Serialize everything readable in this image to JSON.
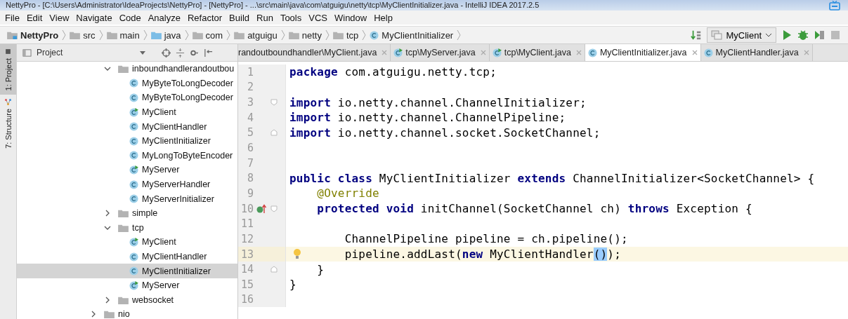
{
  "window": {
    "title": "NettyPro - [C:\\Users\\Administrator\\IdeaProjects\\NettyPro] - [NettyPro] - ...\\src\\main\\java\\com\\atguigu\\netty\\tcp\\MyClientInitializer.java - IntelliJ IDEA 2017.2.5"
  },
  "menu": [
    "File",
    "Edit",
    "View",
    "Navigate",
    "Code",
    "Analyze",
    "Refactor",
    "Build",
    "Run",
    "Tools",
    "VCS",
    "Window",
    "Help"
  ],
  "breadcrumbs": [
    {
      "label": "NettyPro",
      "kind": "module"
    },
    {
      "label": "src",
      "kind": "folder"
    },
    {
      "label": "main",
      "kind": "folder"
    },
    {
      "label": "java",
      "kind": "source"
    },
    {
      "label": "com",
      "kind": "package"
    },
    {
      "label": "atguigu",
      "kind": "package"
    },
    {
      "label": "netty",
      "kind": "package"
    },
    {
      "label": "tcp",
      "kind": "package"
    },
    {
      "label": "MyClientInitializer",
      "kind": "class"
    }
  ],
  "run_config": {
    "label": "MyClient"
  },
  "tool_windows": [
    {
      "label": "1: Project",
      "selected": true,
      "kind": "project"
    },
    {
      "label": "7: Structure",
      "selected": false,
      "kind": "structure"
    }
  ],
  "project_panel": {
    "title": "Project"
  },
  "tree": [
    {
      "children": [
        {
          "label": "inboundhandlerandoutbou",
          "kind": "folder",
          "expanded": true,
          "selected": false,
          "children": [
            {
              "label": "MyByteToLongDecoder",
              "kind": "class",
              "selected": false
            },
            {
              "label": "MyByteToLongDecoder",
              "kind": "class",
              "selected": false
            },
            {
              "label": "MyClient",
              "kind": "main_class",
              "selected": false
            },
            {
              "label": "MyClientHandler",
              "kind": "class",
              "selected": false
            },
            {
              "label": "MyClientInitializer",
              "kind": "class",
              "selected": false
            },
            {
              "label": "MyLongToByteEncoder",
              "kind": "class",
              "selected": false
            },
            {
              "label": "MyServer",
              "kind": "main_class",
              "selected": false
            },
            {
              "label": "MyServerHandler",
              "kind": "class",
              "selected": false
            },
            {
              "label": "MyServerInitializer",
              "kind": "class",
              "selected": false
            }
          ]
        },
        {
          "label": "simple",
          "kind": "folder",
          "expanded": false,
          "selected": false
        },
        {
          "label": "tcp",
          "kind": "folder",
          "expanded": true,
          "selected": false,
          "children": [
            {
              "label": "MyClient",
              "kind": "main_class",
              "selected": false
            },
            {
              "label": "MyClientHandler",
              "kind": "class",
              "selected": false
            },
            {
              "label": "MyClientInitializer",
              "kind": "class",
              "selected": true
            },
            {
              "label": "MyServer",
              "kind": "main_class",
              "selected": false
            }
          ]
        },
        {
          "label": "websocket",
          "kind": "folder",
          "expanded": false,
          "selected": false
        }
      ]
    },
    {
      "label": "nio",
      "kind": "folder",
      "expanded": false,
      "selected": false
    }
  ],
  "tabs": [
    {
      "label": "randoutboundhandler\\MyClient.java",
      "kind": "none",
      "selected": false
    },
    {
      "label": "tcp\\MyServer.java",
      "kind": "main_class",
      "selected": false
    },
    {
      "label": "tcp\\MyClient.java",
      "kind": "main_class",
      "selected": false
    },
    {
      "label": "MyClientInitializer.java",
      "kind": "class",
      "selected": true
    },
    {
      "label": "MyClientHandler.java",
      "kind": "class",
      "selected": false
    }
  ],
  "editor": {
    "lines": [
      {
        "number": "1",
        "segments": [
          {
            "kind": "keyword",
            "text": "package"
          },
          {
            "kind": "plain",
            "text": " com.atguigu.netty.tcp;"
          }
        ]
      },
      {
        "number": "2"
      },
      {
        "number": "3",
        "fold_start": true,
        "segments": [
          {
            "kind": "keyword",
            "text": "import"
          },
          {
            "kind": "plain",
            "text": " io.netty.channel.ChannelInitializer;"
          }
        ]
      },
      {
        "number": "4",
        "segments": [
          {
            "kind": "keyword",
            "text": "import"
          },
          {
            "kind": "plain",
            "text": " io.netty.channel.ChannelPipeline;"
          }
        ]
      },
      {
        "number": "5",
        "fold_end": true,
        "segments": [
          {
            "kind": "keyword",
            "text": "import"
          },
          {
            "kind": "plain",
            "text": " io.netty.channel.socket.SocketChannel;"
          }
        ]
      },
      {
        "number": "6"
      },
      {
        "number": "7"
      },
      {
        "number": "8",
        "segments": [
          {
            "kind": "keyword",
            "text": "public class"
          },
          {
            "kind": "plain",
            "text": " MyClientInitializer "
          },
          {
            "kind": "keyword",
            "text": "extends"
          },
          {
            "kind": "plain",
            "text": " ChannelInitializer<SocketChannel> {"
          }
        ]
      },
      {
        "number": "9",
        "segments": [
          {
            "kind": "annotation",
            "text": "    @Override"
          }
        ]
      },
      {
        "number": "10",
        "fold_start": true,
        "override_marker": true,
        "segments": [
          {
            "kind": "keyword",
            "text": "    protected void"
          },
          {
            "kind": "plain",
            "text": " initChannel(SocketChannel ch) "
          },
          {
            "kind": "keyword",
            "text": "throws"
          },
          {
            "kind": "plain",
            "text": " Exception {"
          }
        ]
      },
      {
        "number": "11"
      },
      {
        "number": "12",
        "segments": [
          {
            "kind": "plain",
            "text": "        ChannelPipeline pipeline = ch.pipeline();"
          }
        ]
      },
      {
        "number": "13",
        "current": true,
        "intention_bulb": true,
        "segments": [
          {
            "kind": "plain",
            "text": "        pipeline.addLast("
          },
          {
            "kind": "keyword",
            "text": "new"
          },
          {
            "kind": "plain",
            "text": " MyClientHandler"
          },
          {
            "kind": "match",
            "text": "()"
          },
          {
            "kind": "plain",
            "text": ");"
          }
        ]
      },
      {
        "number": "14",
        "fold_end": true,
        "segments": [
          {
            "kind": "plain",
            "text": "    }"
          }
        ]
      },
      {
        "number": "15",
        "segments": [
          {
            "kind": "plain",
            "text": "}"
          }
        ]
      },
      {
        "number": "16"
      }
    ]
  }
}
